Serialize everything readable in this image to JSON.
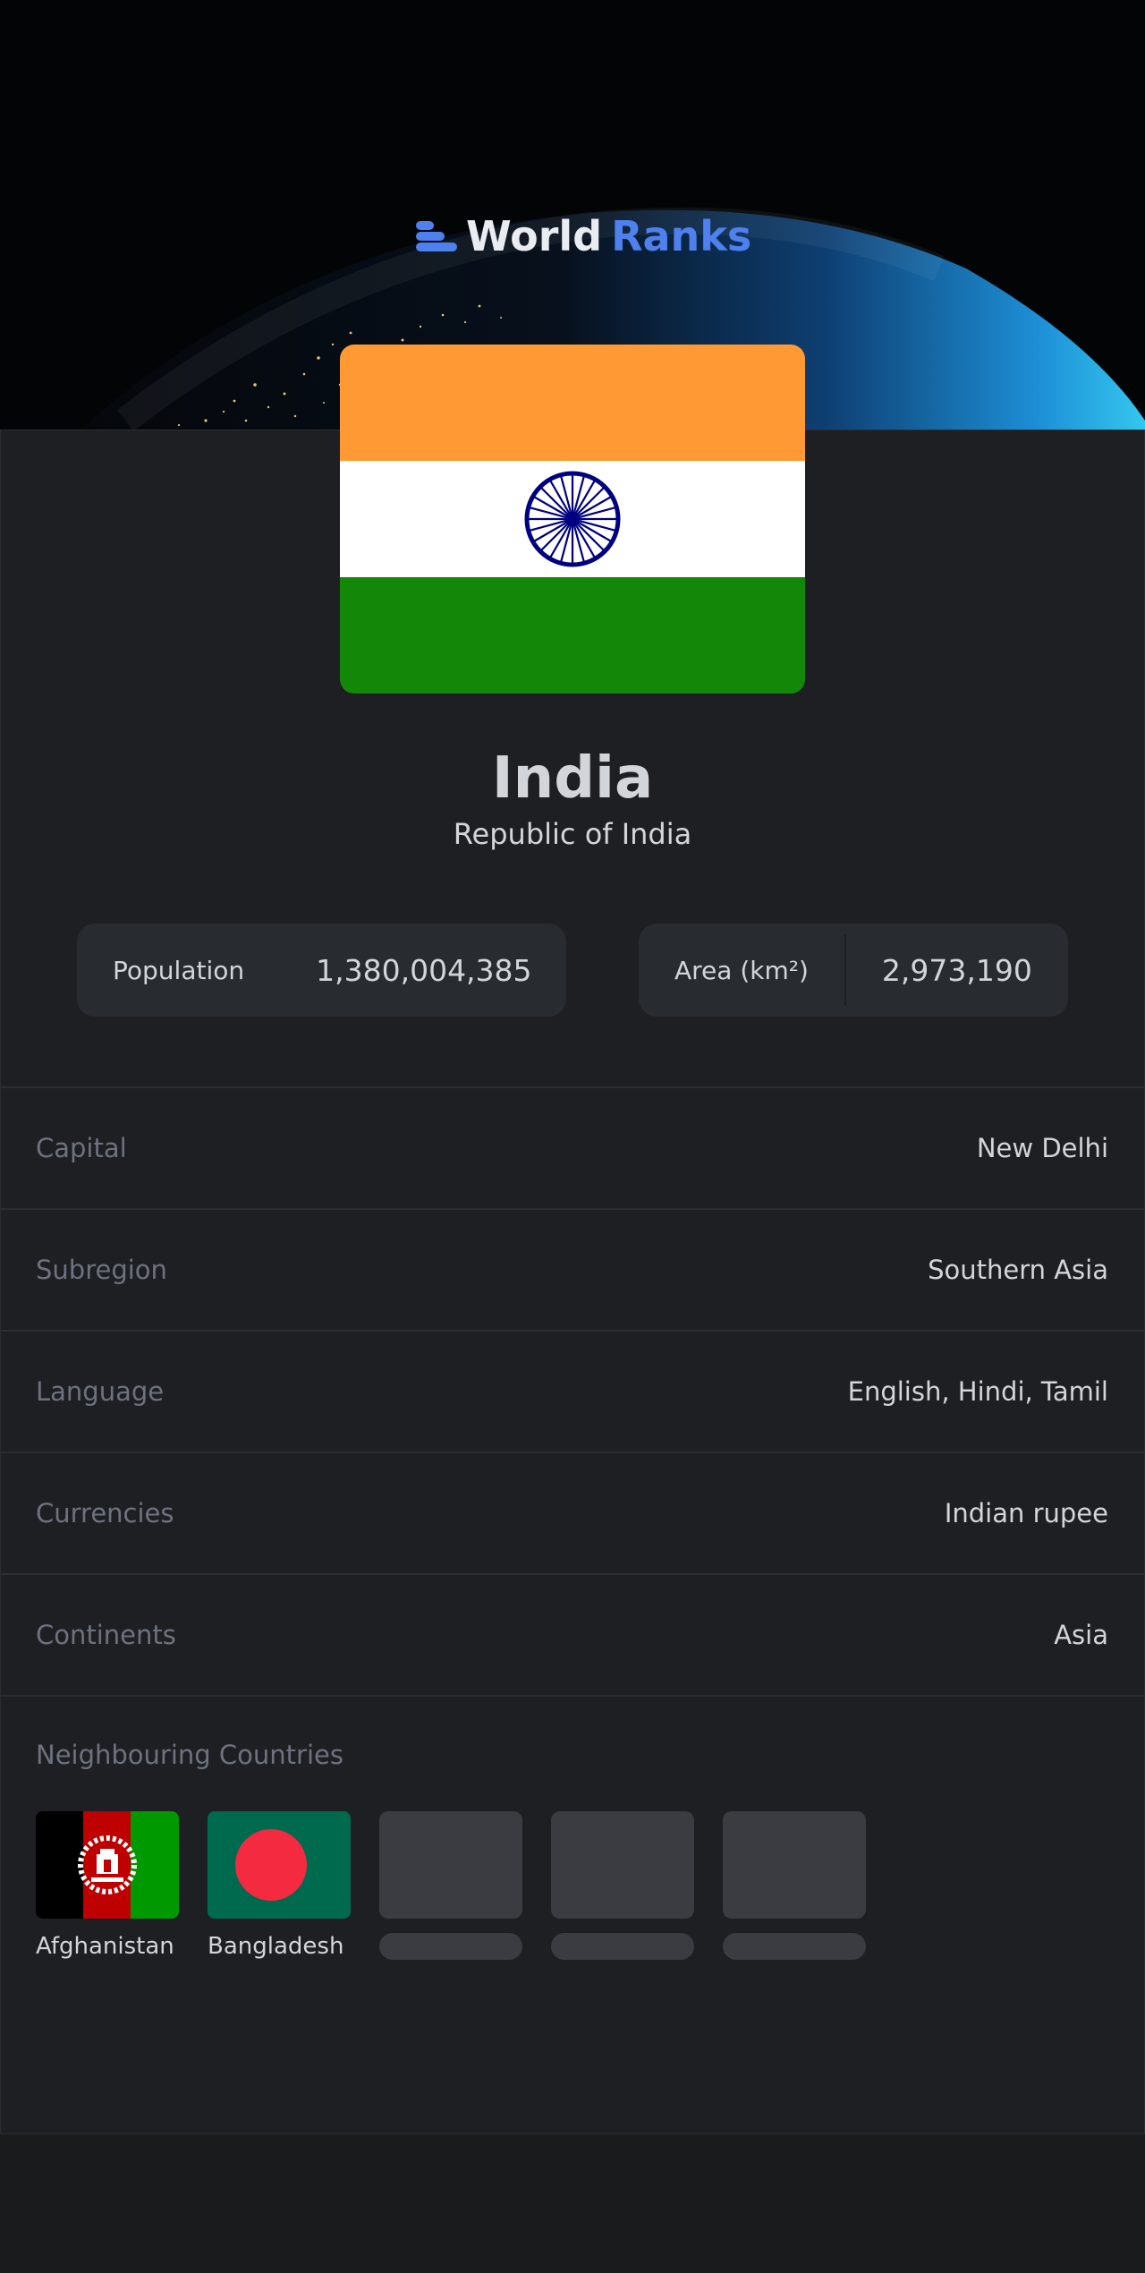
{
  "header": {
    "brand_first": "World",
    "brand_second": "Ranks",
    "logo_icon": "bars-icon",
    "accent_color": "#4e80ee"
  },
  "country": {
    "name": "India",
    "official_name": "Republic of India",
    "flag_icon": "india-flag",
    "flag_colors": [
      "#ff9933",
      "#ffffff",
      "#138808",
      "#000080"
    ]
  },
  "stats": {
    "population_label": "Population",
    "population_value": "1,380,004,385",
    "area_label": "Area (km²)",
    "area_value": "2,973,190"
  },
  "details": [
    {
      "key": "Capital",
      "value": "New Delhi"
    },
    {
      "key": "Subregion",
      "value": "Southern Asia"
    },
    {
      "key": "Language",
      "value": "English, Hindi, Tamil"
    },
    {
      "key": "Currencies",
      "value": "Indian rupee"
    },
    {
      "key": "Continents",
      "value": "Asia"
    }
  ],
  "neighbours": {
    "title": "Neighbouring Countries",
    "items": [
      {
        "name": "Afghanistan",
        "flag_icon": "afghanistan-flag"
      },
      {
        "name": "Bangladesh",
        "flag_icon": "bangladesh-flag"
      }
    ],
    "loading_placeholders": 3
  }
}
